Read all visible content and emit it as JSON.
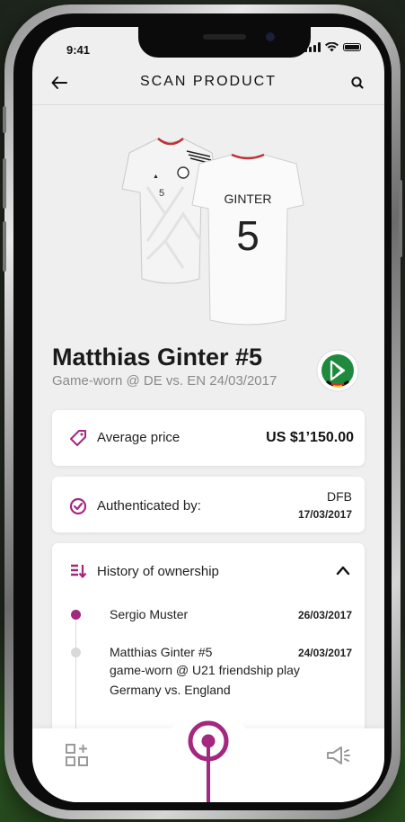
{
  "status_bar": {
    "time": "9:41"
  },
  "header": {
    "title": "SCAN PRODUCT",
    "back_icon": "arrow-left-icon",
    "search_icon": "search-icon"
  },
  "product": {
    "name": "Matthias Ginter #5",
    "subtitle": "Game-worn @ DE vs. EN 24/03/2017",
    "jersey_back_name": "GINTER",
    "jersey_number": "5"
  },
  "price_card": {
    "label": "Average price",
    "value": "US $1’150.00",
    "icon": "tag-icon"
  },
  "auth_card": {
    "label": "Authenticated by:",
    "org": "DFB",
    "date": "17/03/2017",
    "icon": "check-circle-icon"
  },
  "history": {
    "label": "History of ownership",
    "icon": "history-list-icon",
    "entries": [
      {
        "name": "Sergio Muster",
        "date": "26/03/2017",
        "description": ""
      },
      {
        "name": "Matthias Ginter #5",
        "date": "24/03/2017",
        "description_line1": "game-worn @ U21 friendship play",
        "description_line2": "Germany vs. England"
      }
    ]
  },
  "bottom_nav": {
    "left_icon": "add-grid-icon",
    "center_icon": "scan-pin-icon",
    "right_icon": "megaphone-icon"
  },
  "colors": {
    "accent": "#a3287f",
    "background": "#efefef",
    "card": "#ffffff"
  }
}
